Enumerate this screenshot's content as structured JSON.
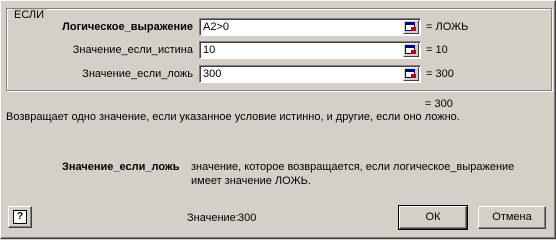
{
  "dialog": {
    "group_title": "ЕСЛИ",
    "args": [
      {
        "label": "Логическое_выражение",
        "value": "A2>0",
        "result": "= ЛОЖЬ",
        "bold": true
      },
      {
        "label": "Значение_если_истина",
        "value": "10",
        "result": "= 10",
        "bold": false
      },
      {
        "label": "Значение_если_ложь",
        "value": "300",
        "result": "= 300",
        "bold": false
      }
    ],
    "formula_result": "= 300",
    "description": "Возвращает одно значение, если указанное условие истинно, и другие, если оно ложно.",
    "arg_help_name": "Значение_если_ложь",
    "arg_help_line1": "значение, которое возвращается, если логическое_выражение",
    "arg_help_line2": "имеет значение ЛОЖЬ.",
    "value_label": "Значение:",
    "value": "300",
    "ok_label": "ОК",
    "cancel_label": "Отмена",
    "help_icon": "help-icon"
  }
}
